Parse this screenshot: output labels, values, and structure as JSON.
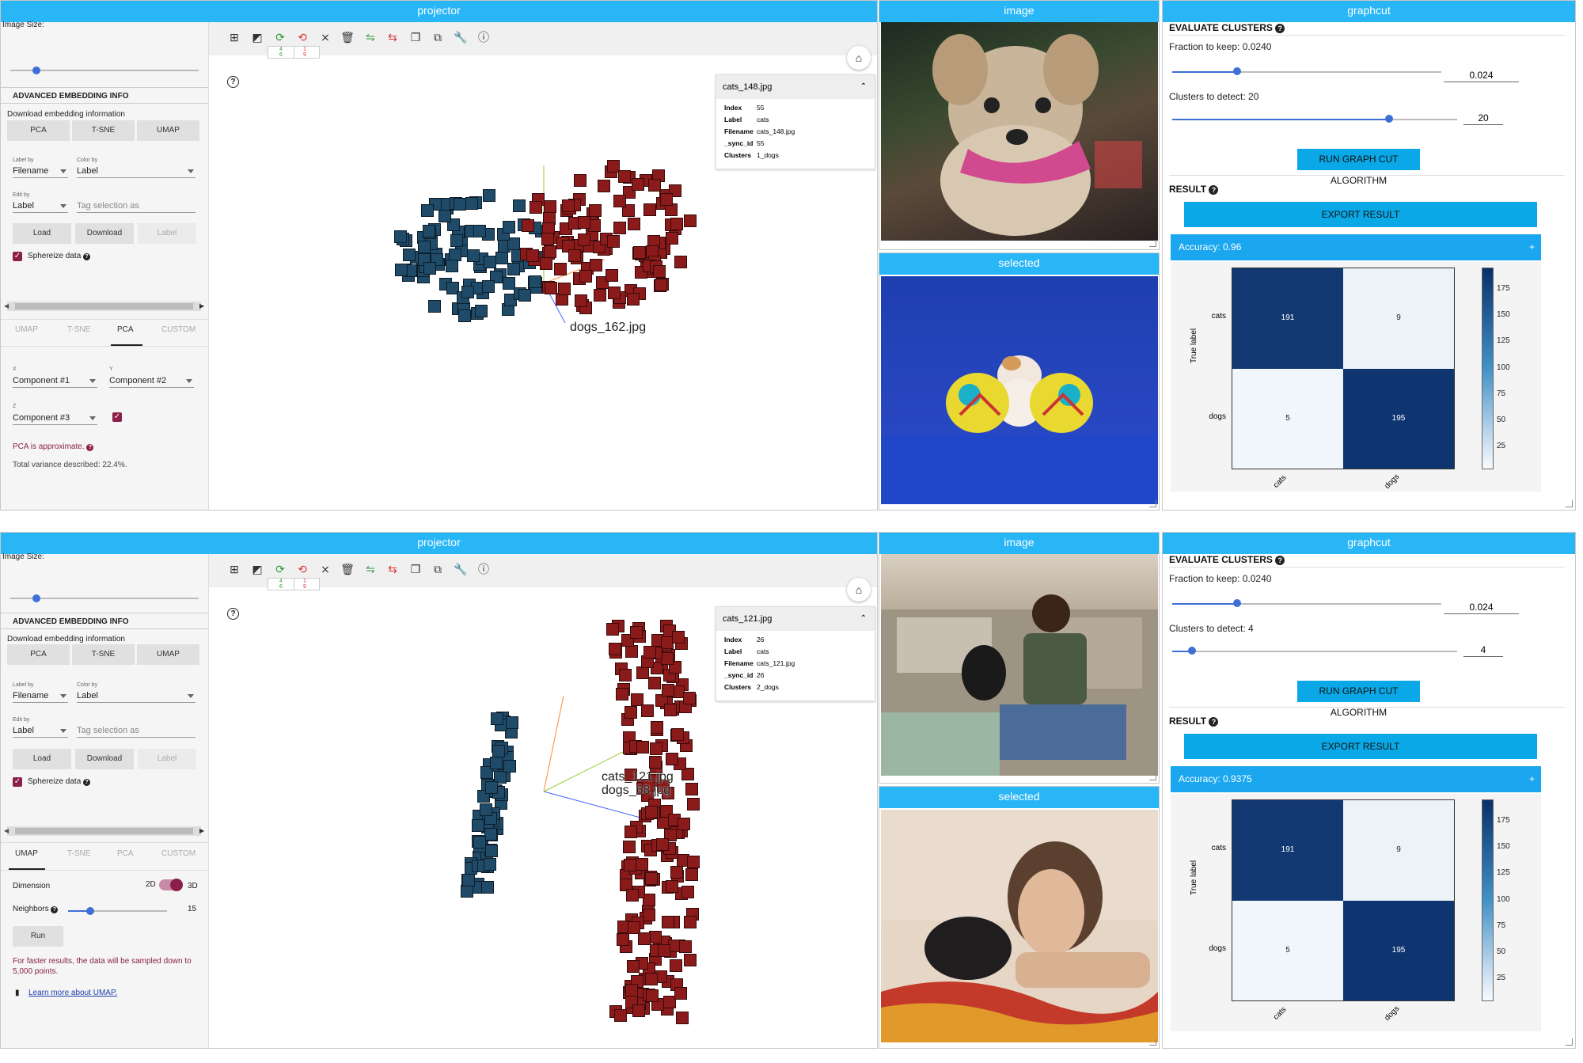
{
  "headers": {
    "projector": "projector",
    "image": "image",
    "graphcut": "graphcut",
    "selected": "selected"
  },
  "sidebar_common": {
    "image_size": "Image Size:",
    "adv_title": "ADVANCED EMBEDDING INFO",
    "download_info": "Download embedding information",
    "btn_pca": "PCA",
    "btn_tsne": "T-SNE",
    "btn_umap": "UMAP",
    "label_by": "Label by",
    "label_by_value": "Filename",
    "color_by": "Color by",
    "color_by_value": "Label",
    "edit_by": "Edit by",
    "edit_by_value": "Label",
    "tag_placeholder": "Tag selection as",
    "load": "Load",
    "download": "Download",
    "label": "Label",
    "sphereize": "Sphereize data",
    "tabs": [
      "UMAP",
      "T-SNE",
      "PCA",
      "CUSTOM"
    ]
  },
  "top": {
    "pca": {
      "x_lbl": "X",
      "x_val": "Component #1",
      "y_lbl": "Y",
      "y_val": "Component #2",
      "z_lbl": "Z",
      "z_val": "Component #3",
      "approx": "PCA is approximate.",
      "variance": "Total variance described: 22.4%."
    },
    "tooltip": {
      "title": "cats_148.jpg",
      "rows": [
        [
          "Index",
          "55"
        ],
        [
          "Label",
          "cats"
        ],
        [
          "Filename",
          "cats_148.jpg"
        ],
        [
          "_sync_id",
          "55"
        ],
        [
          "Clusters",
          "1_dogs"
        ]
      ]
    },
    "point_labels": [
      "dogs_162.jpg"
    ],
    "graphcut": {
      "title": "EVALUATE CLUSTERS",
      "fraction": "Fraction to keep: 0.0240",
      "fraction_val": "0.024",
      "fraction_level": 0.24,
      "clusters": "Clusters to detect: 20",
      "clusters_val": "20",
      "clusters_level": 0.76,
      "run": "RUN GRAPH CUT ALGORITHM",
      "result": "RESULT",
      "export": "EXPORT RESULT",
      "accuracy": "Accuracy: 0.96",
      "plus": "+"
    },
    "toolbar_counts": [
      "4",
      "1",
      "6",
      "9"
    ]
  },
  "bottom": {
    "umap": {
      "dimension": "Dimension",
      "d2": "2D",
      "d3": "3D",
      "neighbors": "Neighbors",
      "neighbors_val": "15",
      "run": "Run",
      "warning": "For faster results, the data will be sampled down to 5,000 points.",
      "learn": "Learn more about UMAP."
    },
    "tooltip": {
      "title": "cats_121.jpg",
      "rows": [
        [
          "Index",
          "26"
        ],
        [
          "Label",
          "cats"
        ],
        [
          "Filename",
          "cats_121.jpg"
        ],
        [
          "_sync_id",
          "26"
        ],
        [
          "Clusters",
          "2_dogs"
        ]
      ]
    },
    "point_labels": [
      "cats_121.jpg",
      "dogs_68.jpg"
    ],
    "graphcut": {
      "title": "EVALUATE CLUSTERS",
      "fraction": "Fraction to keep: 0.0240",
      "fraction_val": "0.024",
      "fraction_level": 0.24,
      "clusters": "Clusters to detect: 4",
      "clusters_val": "4",
      "clusters_level": 0.07,
      "run": "RUN GRAPH CUT ALGORITHM",
      "result": "RESULT",
      "export": "EXPORT RESULT",
      "accuracy": "Accuracy: 0.9375",
      "plus": "+"
    },
    "toolbar_counts": [
      "4",
      "1",
      "6",
      "9"
    ]
  },
  "chart_data": [
    {
      "type": "heatmap",
      "categories": [
        "cats",
        "dogs"
      ],
      "values": [
        [
          191,
          9
        ],
        [
          5,
          195
        ]
      ],
      "ylabel": "True label",
      "colorbar_ticks": [
        25,
        50,
        75,
        100,
        125,
        150,
        175
      ]
    },
    {
      "type": "heatmap",
      "categories": [
        "cats",
        "dogs"
      ],
      "values": [
        [
          191,
          9
        ],
        [
          5,
          195
        ]
      ],
      "ylabel": "True label",
      "colorbar_ticks": [
        25,
        50,
        75,
        100,
        125,
        150,
        175
      ]
    }
  ],
  "colors": {
    "header": "#29b6f6",
    "accent": "#0aa8e6",
    "cats_points": "#8b1a1a",
    "dogs_points": "#1f4a68",
    "checkbox": "#8a1f4a"
  },
  "icons": [
    "add-box-icon",
    "contrast-icon",
    "refresh-icon",
    "refresh-off-icon",
    "no-sync-icon",
    "delete-icon",
    "green-link-icon",
    "red-link-icon",
    "copy-icon",
    "copy-alt-icon",
    "wrench-icon",
    "help-icon",
    "home-icon"
  ]
}
